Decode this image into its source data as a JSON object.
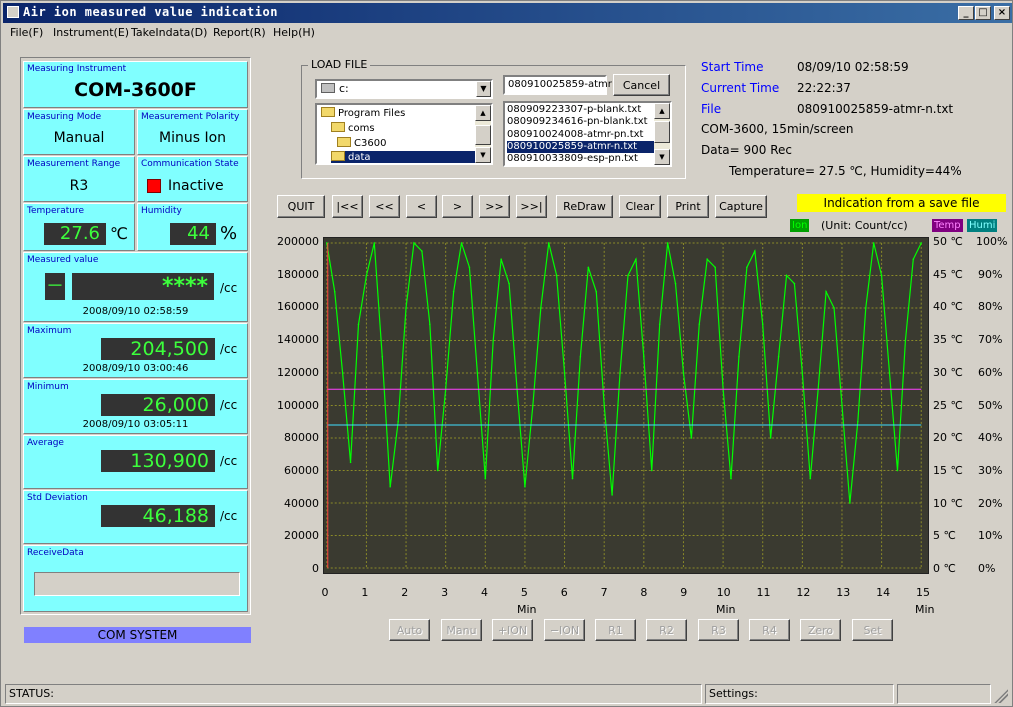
{
  "window": {
    "title": "Air ion measured value indication"
  },
  "menu": [
    "File(F)",
    "Instrument(E)",
    "TakeIndata(D)",
    "Report(R)",
    "Help(H)"
  ],
  "instrument": {
    "label": "Measuring Instrument",
    "value": "COM-3600F"
  },
  "mode": {
    "label": "Measuring Mode",
    "value": "Manual"
  },
  "polarity": {
    "label": "Measurement Polarity",
    "value": "Minus Ion"
  },
  "range": {
    "label": "Measurement Range",
    "value": "R3"
  },
  "comm": {
    "label": "Communication State",
    "value": "Inactive",
    "indicator_color": "#ff0000"
  },
  "temperature": {
    "label": "Temperature",
    "value": "27.6",
    "unit": "℃"
  },
  "humidity": {
    "label": "Humidity",
    "value": "44",
    "unit": "%"
  },
  "measured": {
    "label": "Measured value",
    "sign": "－",
    "value": "****",
    "unit": "/cc",
    "time": "2008/09/10 02:58:59"
  },
  "maximum": {
    "label": "Maximum",
    "value": "204,500",
    "unit": "/cc",
    "time": "2008/09/10 03:00:46"
  },
  "minimum": {
    "label": "Minimum",
    "value": "26,000",
    "unit": "/cc",
    "time": "2008/09/10 03:05:11"
  },
  "average": {
    "label": "Average",
    "value": "130,900",
    "unit": "/cc"
  },
  "stddev": {
    "label": "Std Deviation",
    "value": "46,188",
    "unit": "/cc"
  },
  "receive": {
    "label": "ReceiveData",
    "value": ""
  },
  "com_system": "COM SYSTEM",
  "load_file": {
    "group_label": "LOAD FILE",
    "drive": "c:",
    "folders": [
      "Program Files",
      "coms",
      "C3600",
      "data"
    ],
    "selected_folder_index": 3,
    "filename": "080910025859-atmr",
    "files": [
      "080909223307-p-blank.txt",
      "080909234616-pn-blank.txt",
      "080910024008-atmr-pn.txt",
      "080910025859-atmr-n.txt",
      "080910033809-esp-pn.txt"
    ],
    "selected_file_index": 3,
    "cancel_label": "Cancel"
  },
  "info": {
    "start_label": "Start Time",
    "start_value": "08/09/10 02:58:59",
    "current_label": "Current Time",
    "current_value": "22:22:37",
    "file_label": "File",
    "file_value": "080910025859-atmr-n.txt",
    "device_line": "COM-3600, 15min/screen",
    "data_line": "Data= 900 Rec",
    "env_line": "Temperature= 27.5 ℃, Humidity=44%"
  },
  "toolbar": [
    "QUIT",
    "|<<",
    "<<",
    "<",
    ">",
    ">>",
    ">>|",
    "ReDraw",
    "Clear",
    "Print",
    "Capture"
  ],
  "save_indicator": "Indication from a save file",
  "legend": {
    "ion": "Ion",
    "unit_note": "(Unit: Count/cc)",
    "temp": "Temp",
    "humi": "Humi"
  },
  "bottom_buttons": [
    "Auto",
    "Manu",
    "+ION",
    "−ION",
    "R1",
    "R2",
    "R3",
    "R4",
    "Zero",
    "Set"
  ],
  "status": {
    "status_label": "STATUS:",
    "settings_label": "Settings:"
  },
  "colors": {
    "ion": "#00ff00",
    "temp": "#ff40ff",
    "humi": "#40e0ff",
    "grid": "#8a8a28",
    "plot_bg": "#3a3a30"
  },
  "chart_data": {
    "type": "line",
    "xlabel": "Min",
    "xlim": [
      0,
      15
    ],
    "x_ticks": [
      "0",
      "1",
      "2",
      "3",
      "4",
      "5",
      "6",
      "7",
      "8",
      "9",
      "10",
      "11",
      "12",
      "13",
      "14",
      "15"
    ],
    "ylim": [
      0,
      200000
    ],
    "y_ticks": [
      "200000",
      "180000",
      "160000",
      "140000",
      "120000",
      "100000",
      "80000",
      "60000",
      "40000",
      "20000",
      "0"
    ],
    "temp_ticks": [
      "50 ℃",
      "45 ℃",
      "40 ℃",
      "35 ℃",
      "30 ℃",
      "25 ℃",
      "20 ℃",
      "15 ℃",
      "10 ℃",
      "5 ℃",
      "0 ℃"
    ],
    "humi_ticks": [
      "100%",
      "90%",
      "80%",
      "70%",
      "60%",
      "50%",
      "40%",
      "30%",
      "20%",
      "10%",
      "0%"
    ],
    "series": [
      {
        "name": "Ion",
        "x": [
          0,
          0.2,
          0.4,
          0.6,
          0.8,
          1.0,
          1.2,
          1.4,
          1.6,
          1.8,
          2.0,
          2.2,
          2.4,
          2.6,
          2.8,
          3.0,
          3.2,
          3.4,
          3.6,
          3.8,
          4.0,
          4.2,
          4.4,
          4.6,
          4.8,
          5.0,
          5.2,
          5.4,
          5.6,
          5.8,
          6.0,
          6.2,
          6.4,
          6.6,
          6.8,
          7.0,
          7.2,
          7.4,
          7.6,
          7.8,
          8.0,
          8.2,
          8.4,
          8.6,
          8.8,
          9.0,
          9.2,
          9.4,
          9.6,
          9.8,
          10.0,
          10.2,
          10.4,
          10.6,
          10.8,
          11.0,
          11.2,
          11.4,
          11.6,
          11.8,
          12.0,
          12.2,
          12.4,
          12.6,
          12.8,
          13.0,
          13.2,
          13.4,
          13.6,
          13.8,
          14.0,
          14.2,
          14.4,
          14.6,
          14.8,
          15.0
        ],
        "values": [
          200000,
          170000,
          120000,
          65000,
          150000,
          180000,
          200000,
          130000,
          50000,
          90000,
          160000,
          200000,
          195000,
          150000,
          60000,
          110000,
          170000,
          200000,
          185000,
          120000,
          55000,
          140000,
          190000,
          175000,
          110000,
          50000,
          100000,
          160000,
          200000,
          180000,
          120000,
          55000,
          130000,
          185000,
          170000,
          100000,
          45000,
          120000,
          180000,
          190000,
          130000,
          60000,
          150000,
          200000,
          175000,
          120000,
          80000,
          150000,
          190000,
          185000,
          110000,
          55000,
          130000,
          185000,
          195000,
          150000,
          80000,
          130000,
          180000,
          175000,
          120000,
          55000,
          110000,
          170000,
          160000,
          100000,
          40000,
          90000,
          160000,
          200000,
          180000,
          120000,
          60000,
          140000,
          190000,
          200000
        ]
      },
      {
        "name": "Temp",
        "values_c": [
          27.5
        ]
      },
      {
        "name": "Humi",
        "values_pct": [
          44
        ]
      }
    ]
  }
}
